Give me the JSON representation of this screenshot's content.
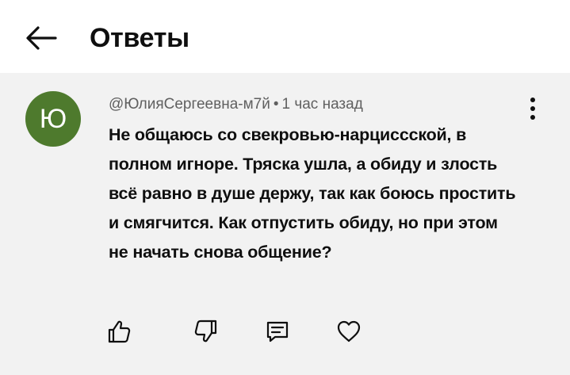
{
  "header": {
    "title": "Ответы",
    "back_icon": "arrow-left-icon"
  },
  "comment": {
    "avatar_letter": "Ю",
    "avatar_color": "#4e7a2d",
    "author": "@ЮлияСергеевна-м7й",
    "separator": "•",
    "time": "1 час назад",
    "text": "Не общаюсь со свекровью-нарциссской, в полном игноре. Тряска ушла, а обиду и злость всё равно в душе держу, так как боюсь простить и смягчится. Как отпустить обиду, но при этом не начать снова общение?",
    "menu_icon": "more-vertical-icon"
  },
  "actions": [
    {
      "name": "like",
      "icon": "thumb-up-icon"
    },
    {
      "name": "dislike",
      "icon": "thumb-down-icon"
    },
    {
      "name": "reply",
      "icon": "reply-icon"
    },
    {
      "name": "heart",
      "icon": "heart-icon"
    }
  ]
}
